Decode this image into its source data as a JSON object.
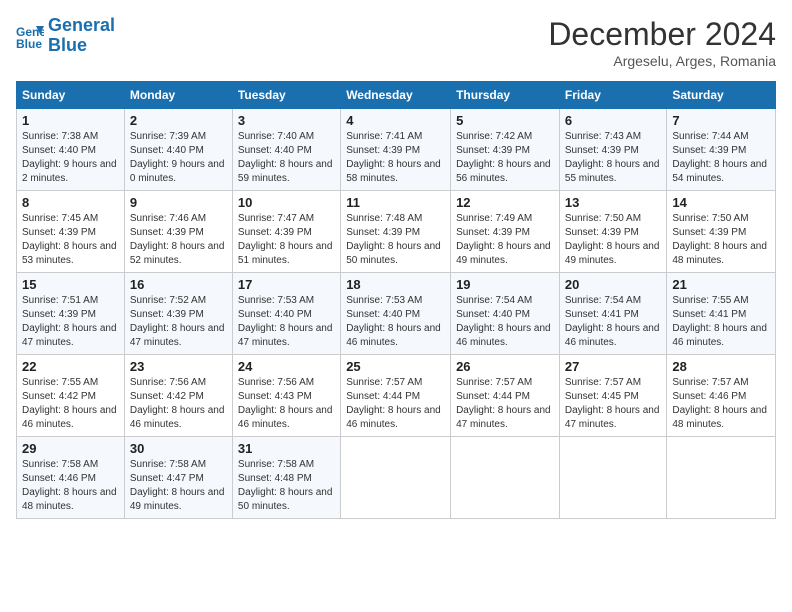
{
  "logo": {
    "line1": "General",
    "line2": "Blue"
  },
  "title": "December 2024",
  "subtitle": "Argeselu, Arges, Romania",
  "days_header": [
    "Sunday",
    "Monday",
    "Tuesday",
    "Wednesday",
    "Thursday",
    "Friday",
    "Saturday"
  ],
  "weeks": [
    [
      {
        "day": "1",
        "sunrise": "Sunrise: 7:38 AM",
        "sunset": "Sunset: 4:40 PM",
        "daylight": "Daylight: 9 hours and 2 minutes."
      },
      {
        "day": "2",
        "sunrise": "Sunrise: 7:39 AM",
        "sunset": "Sunset: 4:40 PM",
        "daylight": "Daylight: 9 hours and 0 minutes."
      },
      {
        "day": "3",
        "sunrise": "Sunrise: 7:40 AM",
        "sunset": "Sunset: 4:40 PM",
        "daylight": "Daylight: 8 hours and 59 minutes."
      },
      {
        "day": "4",
        "sunrise": "Sunrise: 7:41 AM",
        "sunset": "Sunset: 4:39 PM",
        "daylight": "Daylight: 8 hours and 58 minutes."
      },
      {
        "day": "5",
        "sunrise": "Sunrise: 7:42 AM",
        "sunset": "Sunset: 4:39 PM",
        "daylight": "Daylight: 8 hours and 56 minutes."
      },
      {
        "day": "6",
        "sunrise": "Sunrise: 7:43 AM",
        "sunset": "Sunset: 4:39 PM",
        "daylight": "Daylight: 8 hours and 55 minutes."
      },
      {
        "day": "7",
        "sunrise": "Sunrise: 7:44 AM",
        "sunset": "Sunset: 4:39 PM",
        "daylight": "Daylight: 8 hours and 54 minutes."
      }
    ],
    [
      {
        "day": "8",
        "sunrise": "Sunrise: 7:45 AM",
        "sunset": "Sunset: 4:39 PM",
        "daylight": "Daylight: 8 hours and 53 minutes."
      },
      {
        "day": "9",
        "sunrise": "Sunrise: 7:46 AM",
        "sunset": "Sunset: 4:39 PM",
        "daylight": "Daylight: 8 hours and 52 minutes."
      },
      {
        "day": "10",
        "sunrise": "Sunrise: 7:47 AM",
        "sunset": "Sunset: 4:39 PM",
        "daylight": "Daylight: 8 hours and 51 minutes."
      },
      {
        "day": "11",
        "sunrise": "Sunrise: 7:48 AM",
        "sunset": "Sunset: 4:39 PM",
        "daylight": "Daylight: 8 hours and 50 minutes."
      },
      {
        "day": "12",
        "sunrise": "Sunrise: 7:49 AM",
        "sunset": "Sunset: 4:39 PM",
        "daylight": "Daylight: 8 hours and 49 minutes."
      },
      {
        "day": "13",
        "sunrise": "Sunrise: 7:50 AM",
        "sunset": "Sunset: 4:39 PM",
        "daylight": "Daylight: 8 hours and 49 minutes."
      },
      {
        "day": "14",
        "sunrise": "Sunrise: 7:50 AM",
        "sunset": "Sunset: 4:39 PM",
        "daylight": "Daylight: 8 hours and 48 minutes."
      }
    ],
    [
      {
        "day": "15",
        "sunrise": "Sunrise: 7:51 AM",
        "sunset": "Sunset: 4:39 PM",
        "daylight": "Daylight: 8 hours and 47 minutes."
      },
      {
        "day": "16",
        "sunrise": "Sunrise: 7:52 AM",
        "sunset": "Sunset: 4:39 PM",
        "daylight": "Daylight: 8 hours and 47 minutes."
      },
      {
        "day": "17",
        "sunrise": "Sunrise: 7:53 AM",
        "sunset": "Sunset: 4:40 PM",
        "daylight": "Daylight: 8 hours and 47 minutes."
      },
      {
        "day": "18",
        "sunrise": "Sunrise: 7:53 AM",
        "sunset": "Sunset: 4:40 PM",
        "daylight": "Daylight: 8 hours and 46 minutes."
      },
      {
        "day": "19",
        "sunrise": "Sunrise: 7:54 AM",
        "sunset": "Sunset: 4:40 PM",
        "daylight": "Daylight: 8 hours and 46 minutes."
      },
      {
        "day": "20",
        "sunrise": "Sunrise: 7:54 AM",
        "sunset": "Sunset: 4:41 PM",
        "daylight": "Daylight: 8 hours and 46 minutes."
      },
      {
        "day": "21",
        "sunrise": "Sunrise: 7:55 AM",
        "sunset": "Sunset: 4:41 PM",
        "daylight": "Daylight: 8 hours and 46 minutes."
      }
    ],
    [
      {
        "day": "22",
        "sunrise": "Sunrise: 7:55 AM",
        "sunset": "Sunset: 4:42 PM",
        "daylight": "Daylight: 8 hours and 46 minutes."
      },
      {
        "day": "23",
        "sunrise": "Sunrise: 7:56 AM",
        "sunset": "Sunset: 4:42 PM",
        "daylight": "Daylight: 8 hours and 46 minutes."
      },
      {
        "day": "24",
        "sunrise": "Sunrise: 7:56 AM",
        "sunset": "Sunset: 4:43 PM",
        "daylight": "Daylight: 8 hours and 46 minutes."
      },
      {
        "day": "25",
        "sunrise": "Sunrise: 7:57 AM",
        "sunset": "Sunset: 4:44 PM",
        "daylight": "Daylight: 8 hours and 46 minutes."
      },
      {
        "day": "26",
        "sunrise": "Sunrise: 7:57 AM",
        "sunset": "Sunset: 4:44 PM",
        "daylight": "Daylight: 8 hours and 47 minutes."
      },
      {
        "day": "27",
        "sunrise": "Sunrise: 7:57 AM",
        "sunset": "Sunset: 4:45 PM",
        "daylight": "Daylight: 8 hours and 47 minutes."
      },
      {
        "day": "28",
        "sunrise": "Sunrise: 7:57 AM",
        "sunset": "Sunset: 4:46 PM",
        "daylight": "Daylight: 8 hours and 48 minutes."
      }
    ],
    [
      {
        "day": "29",
        "sunrise": "Sunrise: 7:58 AM",
        "sunset": "Sunset: 4:46 PM",
        "daylight": "Daylight: 8 hours and 48 minutes."
      },
      {
        "day": "30",
        "sunrise": "Sunrise: 7:58 AM",
        "sunset": "Sunset: 4:47 PM",
        "daylight": "Daylight: 8 hours and 49 minutes."
      },
      {
        "day": "31",
        "sunrise": "Sunrise: 7:58 AM",
        "sunset": "Sunset: 4:48 PM",
        "daylight": "Daylight: 8 hours and 50 minutes."
      },
      null,
      null,
      null,
      null
    ]
  ]
}
